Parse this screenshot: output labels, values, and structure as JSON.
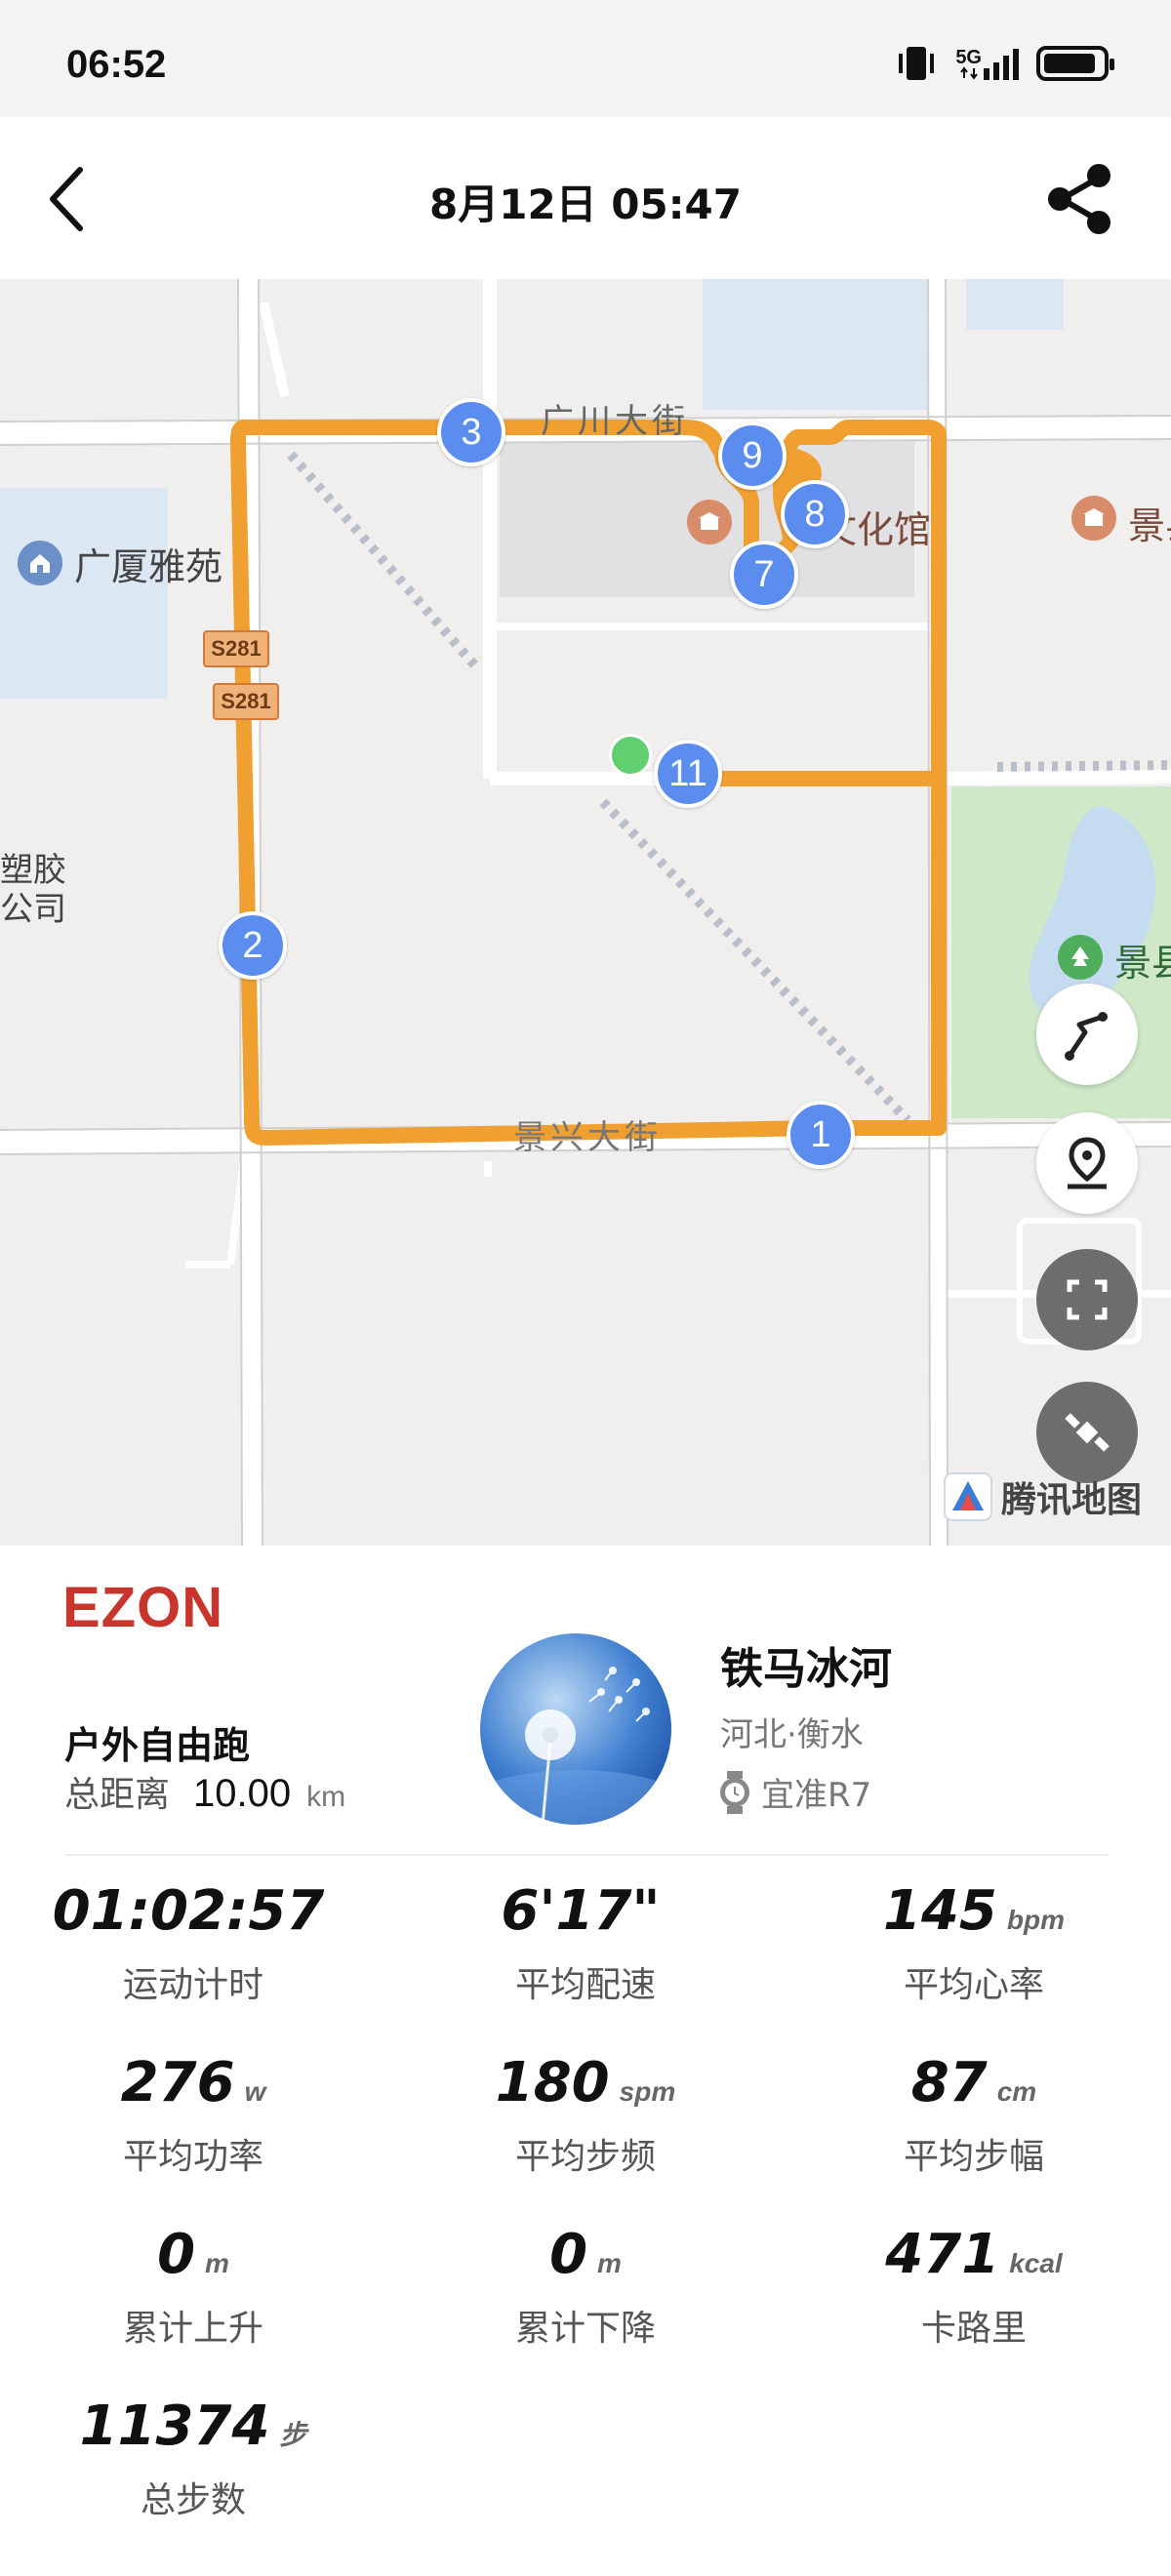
{
  "status_bar": {
    "time": "06:52",
    "network": "5G"
  },
  "header": {
    "title": "8月12日  05:47"
  },
  "map": {
    "street_labels": {
      "top": "广川大街",
      "bottom": "景兴大街"
    },
    "poi": {
      "yasha": "广厦雅苑",
      "plastic_line1": "塑胶",
      "plastic_line2": "公司",
      "culture": "文化馆",
      "right": "景县",
      "park": "景县"
    },
    "road_badges": [
      "S281",
      "S281"
    ],
    "markers": [
      "1",
      "2",
      "3",
      "7",
      "8",
      "9",
      "11"
    ],
    "provider": "腾讯地图"
  },
  "summary": {
    "brand": "EZON",
    "activity_type": "户外自由跑",
    "distance_label": "总距离",
    "distance_value": "10.00",
    "distance_unit": "km",
    "user_name": "铁马冰河",
    "user_location": "河北·衡水",
    "device_name": "宜准R7"
  },
  "stats": [
    {
      "value": "01:02:57",
      "unit": "",
      "label": "运动计时"
    },
    {
      "value": "6'17\"",
      "unit": "",
      "label": "平均配速"
    },
    {
      "value": "145",
      "unit": "bpm",
      "label": "平均心率"
    },
    {
      "value": "276",
      "unit": "w",
      "label": "平均功率"
    },
    {
      "value": "180",
      "unit": "spm",
      "label": "平均步频"
    },
    {
      "value": "87",
      "unit": "cm",
      "label": "平均步幅"
    },
    {
      "value": "0",
      "unit": "m",
      "label": "累计上升"
    },
    {
      "value": "0",
      "unit": "m",
      "label": "累计下降"
    },
    {
      "value": "471",
      "unit": "kcal",
      "label": "卡路里"
    },
    {
      "value": "11374",
      "unit": "步",
      "label": "总步数"
    }
  ],
  "colors": {
    "route": "#f0a030",
    "marker": "#5b8def",
    "brand": "#c8352d",
    "start": "#5fcf6f"
  }
}
